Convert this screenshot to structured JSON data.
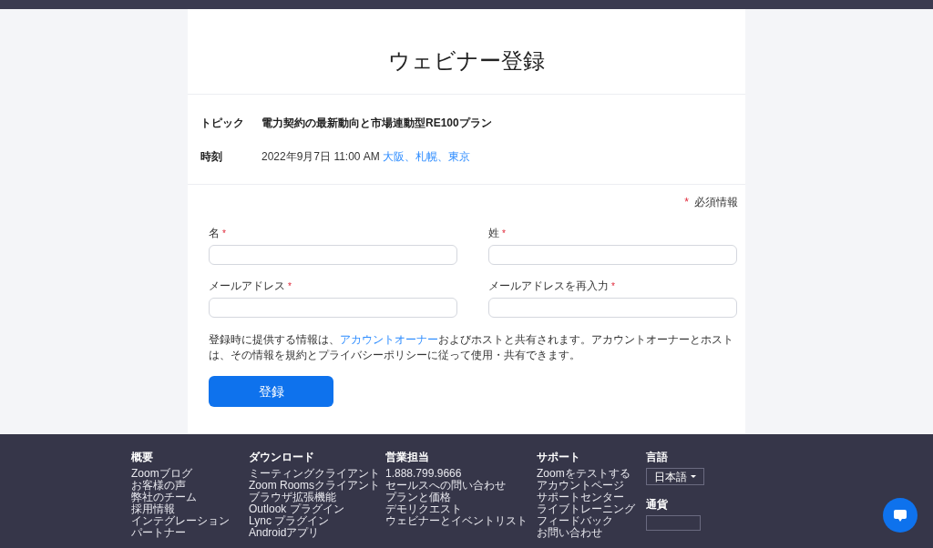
{
  "page": {
    "title": "ウェビナー登録"
  },
  "details": [
    {
      "kind": "topic",
      "label": "トピック",
      "value": "電力契約の最新動向と市場連動型RE100プラン"
    },
    {
      "kind": "time",
      "label": "時刻",
      "value": "2022年9月7日 11:00 AM",
      "timezone": "大阪、札幌、東京"
    }
  ],
  "required_note": {
    "mark": "*",
    "text": "必須情報"
  },
  "fields": [
    {
      "label": "名",
      "required": true
    },
    {
      "label": "姓",
      "required": true
    },
    {
      "label": "メールアドレス",
      "required": true
    },
    {
      "label": "メールアドレスを再入力",
      "required": true
    }
  ],
  "disclaimer": {
    "before": "登録時に提供する情報は、",
    "link": "アカウントオーナー",
    "after": "およびホストと共有されます。アカウントオーナーとホストは、その情報を規約とプライバシーポリシーに従って使用・共有できます。"
  },
  "submit_button": "登録",
  "footer": {
    "columns": [
      {
        "heading": "概要",
        "links": [
          "Zoomブログ",
          "お客様の声",
          "弊社のチーム",
          "採用情報",
          "インテグレーション",
          "パートナー"
        ]
      },
      {
        "heading": "ダウンロード",
        "links": [
          "ミーティングクライアント",
          "Zoom Roomsクライアント",
          "ブラウザ拡張機能",
          "Outlook プラグイン",
          "Lync プラグイン",
          "Androidアプリ"
        ]
      },
      {
        "heading": "営業担当",
        "links": [
          "1.888.799.9666",
          "セールスへの問い合わせ",
          "プランと価格",
          "デモリクエスト",
          "ウェビナーとイベントリスト"
        ]
      },
      {
        "heading": "サポート",
        "links": [
          "Zoomをテストする",
          "アカウントページ",
          "サポートセンター",
          "ライブトレーニング",
          "フィードバック",
          "お問い合わせ"
        ]
      }
    ],
    "language": {
      "heading": "言語",
      "value": "日本語"
    },
    "currency": {
      "heading": "通貨"
    }
  }
}
